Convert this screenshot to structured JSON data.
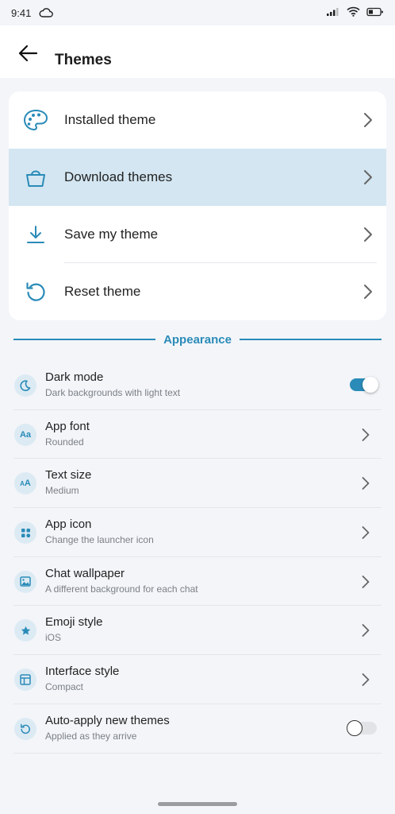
{
  "status_bar": {
    "time": "9:41",
    "icons": [
      "cloud-icon",
      "signal-icon",
      "wifi-icon",
      "battery-icon"
    ]
  },
  "header": {
    "title": "Themes",
    "back_icon": "arrow-left-icon"
  },
  "theme_menu": [
    {
      "label": "Installed theme",
      "icon": "palette-icon",
      "active": false
    },
    {
      "label": "Download themes",
      "icon": "shopping-basket-icon",
      "active": true
    },
    {
      "label": "Save my theme",
      "icon": "download-icon",
      "active": false
    },
    {
      "label": "Reset theme",
      "icon": "reset-icon",
      "active": false
    }
  ],
  "appearance": {
    "section_title": "Appearance",
    "items": [
      {
        "title": "Dark mode",
        "subtitle": "Dark backgrounds with light text",
        "icon": "moon-icon",
        "control": "toggle",
        "on": true
      },
      {
        "title": "App font",
        "subtitle": "Rounded",
        "icon": "font-icon",
        "icon_text": "Aa",
        "control": "chevron"
      },
      {
        "title": "Text size",
        "subtitle": "Medium",
        "icon": "text-size-icon",
        "icon_text": "AA",
        "control": "chevron"
      },
      {
        "title": "App icon",
        "subtitle": "Change the launcher icon",
        "icon": "grid-icon",
        "control": "chevron"
      },
      {
        "title": "Chat wallpaper",
        "subtitle": "A different background for each chat",
        "icon": "image-icon",
        "control": "chevron"
      },
      {
        "title": "Emoji style",
        "subtitle": "iOS",
        "icon": "star-icon",
        "control": "chevron"
      },
      {
        "title": "Interface style",
        "subtitle": "Compact",
        "icon": "layout-icon",
        "control": "chevron"
      },
      {
        "title": "Auto-apply new themes",
        "subtitle": "Applied as they arrive",
        "icon": "refresh-icon",
        "control": "toggle",
        "on": false
      }
    ]
  },
  "colors": {
    "accent": "#2a8bb8",
    "active_row": "#d3e6f1",
    "background": "#f3f5f9"
  }
}
